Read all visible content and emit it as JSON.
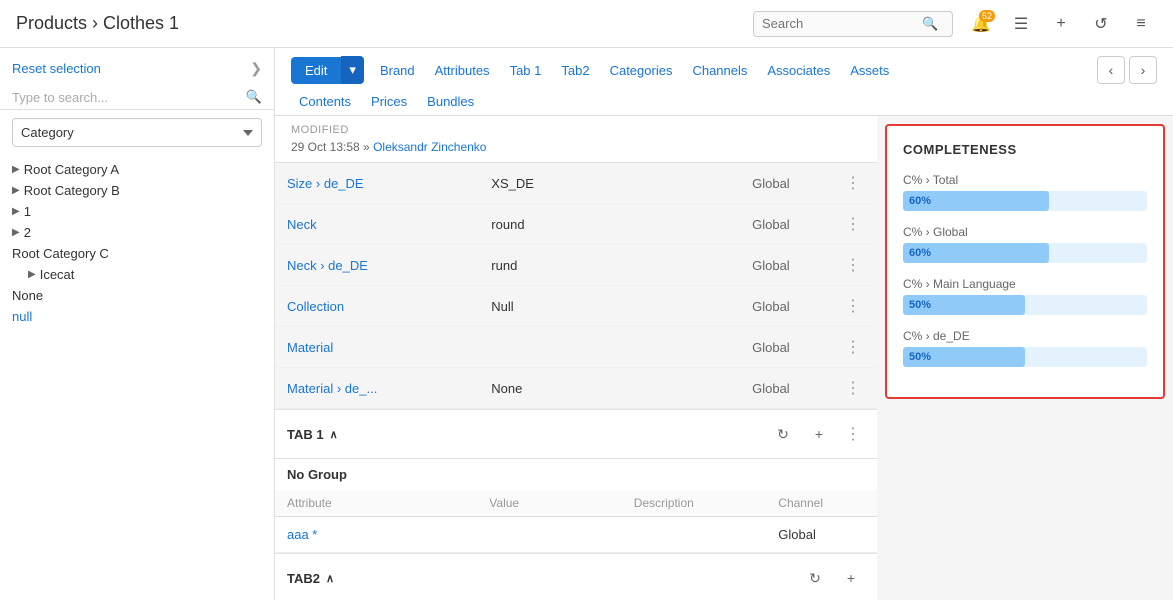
{
  "header": {
    "title": "Products › Clothes 1",
    "search_placeholder": "Search"
  },
  "sidebar": {
    "reset_label": "Reset selection",
    "search_placeholder": "Type to search...",
    "category_options": [
      "Category"
    ],
    "tree_items": [
      {
        "label": "Root Category A",
        "has_arrow": true,
        "indent": 0
      },
      {
        "label": "Root Category B",
        "has_arrow": true,
        "indent": 0
      },
      {
        "label": "1",
        "has_arrow": true,
        "indent": 0
      },
      {
        "label": "2",
        "has_arrow": true,
        "indent": 0
      },
      {
        "label": "Root Category C",
        "has_arrow": false,
        "indent": 0
      },
      {
        "label": "Icecat",
        "has_arrow": true,
        "indent": 1
      },
      {
        "label": "None",
        "has_arrow": false,
        "indent": 0
      },
      {
        "label": "null",
        "has_arrow": false,
        "indent": 0,
        "is_link": true
      }
    ]
  },
  "tabs": {
    "edit_label": "Edit",
    "tab_links": [
      "Brand",
      "Attributes",
      "Tab 1",
      "Tab2",
      "Categories",
      "Channels",
      "Associates",
      "Assets"
    ],
    "tab_links2": [
      "Contents",
      "Prices",
      "Bundles"
    ]
  },
  "attributes": [
    {
      "name": "Size › de_DE",
      "value": "XS_DE",
      "scope": "Global"
    },
    {
      "name": "Neck",
      "value": "round",
      "scope": "Global"
    },
    {
      "name": "Neck › de_DE",
      "value": "rund",
      "scope": "Global"
    },
    {
      "name": "Collection",
      "value": "Null",
      "scope": "Global"
    },
    {
      "name": "Material",
      "value": "",
      "scope": "Global"
    },
    {
      "name": "Material › de_...",
      "value": "None",
      "scope": "Global"
    }
  ],
  "tab1": {
    "title": "TAB 1",
    "no_group": "No Group",
    "col_headers": [
      "Attribute",
      "Value",
      "Description",
      "Channel"
    ],
    "rows": [
      {
        "name": "aaa *",
        "value": "",
        "description": "",
        "channel": "Global"
      }
    ]
  },
  "tab2": {
    "title": "TAB2"
  },
  "completeness": {
    "title": "COMPLETENESS",
    "items": [
      {
        "label": "C% › Total",
        "percent": 60,
        "display": "60%"
      },
      {
        "label": "C% › Global",
        "percent": 60,
        "display": "60%"
      },
      {
        "label": "C% › Main Language",
        "percent": 50,
        "display": "50%"
      },
      {
        "label": "C% › de_DE",
        "percent": 50,
        "display": "50%"
      }
    ]
  },
  "modified": {
    "label": "Modified",
    "date": "29 Oct 13:58 »",
    "user": "Oleksandr Zinchenko"
  },
  "icons": {
    "search": "🔍",
    "bell": "🔔",
    "badge_count": "52",
    "list": "☰",
    "plus": "+",
    "history": "↺",
    "menu": "≡",
    "chevron_left": "‹",
    "chevron_right": "›",
    "collapse": "❯",
    "dots": "⋮",
    "refresh": "↻",
    "caret": "∧"
  }
}
